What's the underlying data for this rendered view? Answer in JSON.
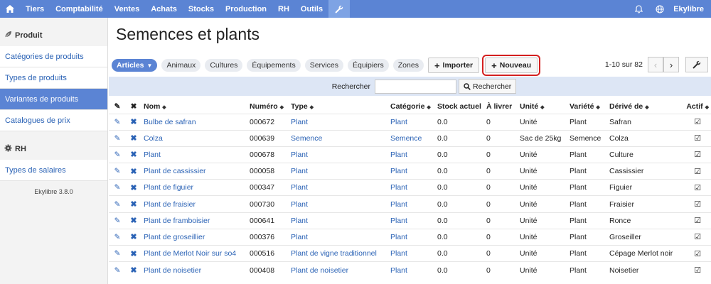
{
  "topnav": {
    "items": [
      "Tiers",
      "Comptabilité",
      "Ventes",
      "Achats",
      "Stocks",
      "Production",
      "RH",
      "Outils"
    ],
    "user": "Ekylibre"
  },
  "sidebar": {
    "sections": [
      {
        "title": "Produit",
        "icon": "leaf-icon",
        "items": [
          "Catégories de produits",
          "Types de produits",
          "Variantes de produits",
          "Catalogues de prix"
        ]
      },
      {
        "title": "RH",
        "icon": "gear-icon",
        "items": [
          "Types de salaires"
        ]
      }
    ],
    "version": "Ekylibre 3.8.0"
  },
  "page": {
    "title": "Semences et plants"
  },
  "toolbar": {
    "filters": [
      "Articles",
      "Animaux",
      "Cultures",
      "Équipements",
      "Services",
      "Équipiers",
      "Zones"
    ],
    "import_label": "Importer",
    "new_label": "Nouveau",
    "pager_text": "1-10 sur 82"
  },
  "search": {
    "label": "Rechercher",
    "button": "Rechercher",
    "value": ""
  },
  "table": {
    "headers": [
      "Nom",
      "Numéro",
      "Type",
      "Catégorie",
      "Stock actuel",
      "À livrer",
      "Unité",
      "Variété",
      "Dérivé de",
      "Actif"
    ],
    "rows": [
      [
        "Bulbe de safran",
        "000672",
        "Plant",
        "Plant",
        "0.0",
        "0",
        "Unité",
        "Plant",
        "Safran"
      ],
      [
        "Colza",
        "000639",
        "Semence",
        "Semence",
        "0.0",
        "0",
        "Sac de 25kg",
        "Semence",
        "Colza"
      ],
      [
        "Plant",
        "000678",
        "Plant",
        "Plant",
        "0.0",
        "0",
        "Unité",
        "Plant",
        "Culture"
      ],
      [
        "Plant de cassissier",
        "000058",
        "Plant",
        "Plant",
        "0.0",
        "0",
        "Unité",
        "Plant",
        "Cassissier"
      ],
      [
        "Plant de figuier",
        "000347",
        "Plant",
        "Plant",
        "0.0",
        "0",
        "Unité",
        "Plant",
        "Figuier"
      ],
      [
        "Plant de fraisier",
        "000730",
        "Plant",
        "Plant",
        "0.0",
        "0",
        "Unité",
        "Plant",
        "Fraisier"
      ],
      [
        "Plant de framboisier",
        "000641",
        "Plant",
        "Plant",
        "0.0",
        "0",
        "Unité",
        "Plant",
        "Ronce"
      ],
      [
        "Plant de groseillier",
        "000376",
        "Plant",
        "Plant",
        "0.0",
        "0",
        "Unité",
        "Plant",
        "Groseiller"
      ],
      [
        "Plant de Merlot Noir sur so4",
        "000516",
        "Plant de vigne traditionnel",
        "Plant",
        "0.0",
        "0",
        "Unité",
        "Plant",
        "Cépage Merlot noir"
      ],
      [
        "Plant de noisetier",
        "000408",
        "Plant de noisetier",
        "Plant",
        "0.0",
        "0",
        "Unité",
        "Plant",
        "Noisetier"
      ]
    ]
  }
}
